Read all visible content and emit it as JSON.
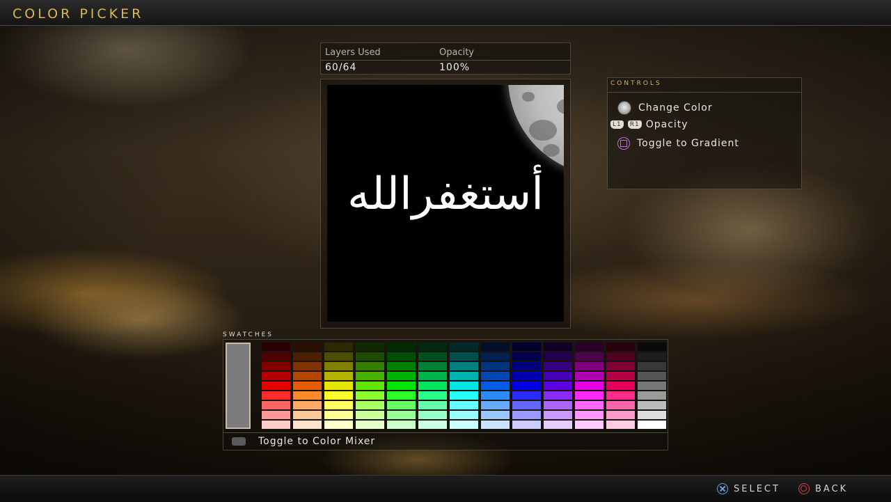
{
  "header": {
    "title": "COLOR PICKER"
  },
  "info": {
    "layers_label": "Layers Used",
    "layers_value": "60/64",
    "opacity_label": "Opacity",
    "opacity_value": "100%"
  },
  "canvas": {
    "calligraphy_text": "أستغفرالله"
  },
  "controls": {
    "title": "CONTROLS",
    "items": [
      {
        "icon": "right-stick-icon",
        "label": "Change Color"
      },
      {
        "icon": "l1-r1-icon",
        "label": "Opacity",
        "icon_text_l": "L1",
        "icon_text_r": "R1"
      },
      {
        "icon": "square-button-icon",
        "label": "Toggle to Gradient"
      }
    ]
  },
  "swatches": {
    "title": "SWATCHES",
    "selected_color": "#7c7c7c",
    "toggle_label": "Toggle to Color Mixer",
    "rows": [
      [
        "#2a0000",
        "#2a1000",
        "#2a2a00",
        "#102a00",
        "#002a00",
        "#002a10",
        "#002a2a",
        "#00102a",
        "#00002a",
        "#10002a",
        "#2a002a",
        "#2a0010",
        "#0a0a0a"
      ],
      [
        "#4d0000",
        "#4d2000",
        "#4d4d00",
        "#1e4d00",
        "#004d00",
        "#004d20",
        "#004d4d",
        "#00204d",
        "#00004d",
        "#20004d",
        "#4d004d",
        "#4d0020",
        "#1c1c1c"
      ],
      [
        "#800000",
        "#803300",
        "#808000",
        "#338000",
        "#008000",
        "#008033",
        "#008080",
        "#003380",
        "#000080",
        "#330080",
        "#800080",
        "#800033",
        "#383838"
      ],
      [
        "#b30000",
        "#b34700",
        "#b3b300",
        "#47b300",
        "#00b300",
        "#00b347",
        "#00b3b3",
        "#0047b3",
        "#0000b3",
        "#4700b3",
        "#b300b3",
        "#b30047",
        "#555555"
      ],
      [
        "#e60000",
        "#e65c00",
        "#e6e600",
        "#5ce600",
        "#00e600",
        "#00e65c",
        "#00e6e6",
        "#005ce6",
        "#0000e6",
        "#5c00e6",
        "#e600e6",
        "#e6005c",
        "#777777"
      ],
      [
        "#ff2a2a",
        "#ff8a2a",
        "#ffff2a",
        "#8aff2a",
        "#2aff2a",
        "#2aff8a",
        "#2affff",
        "#2a8aff",
        "#2a2aff",
        "#8a2aff",
        "#ff2aff",
        "#ff2a8a",
        "#999999"
      ],
      [
        "#ff6666",
        "#ffaa66",
        "#ffff66",
        "#aaff66",
        "#66ff66",
        "#66ffaa",
        "#66ffff",
        "#66aaff",
        "#6666ff",
        "#aa66ff",
        "#ff66ff",
        "#ff66aa",
        "#bbbbbb"
      ],
      [
        "#ff9999",
        "#ffc899",
        "#ffff99",
        "#c8ff99",
        "#99ff99",
        "#99ffc8",
        "#99ffff",
        "#99c8ff",
        "#9999ff",
        "#c899ff",
        "#ff99ff",
        "#ff99c8",
        "#dddddd"
      ],
      [
        "#ffcccc",
        "#ffe4cc",
        "#ffffcc",
        "#e4ffcc",
        "#ccffcc",
        "#ccffe4",
        "#ccffff",
        "#cce4ff",
        "#ccccff",
        "#e4ccff",
        "#ffccff",
        "#ffcce4",
        "#ffffff"
      ]
    ]
  },
  "footer": {
    "select_label": "SELECT",
    "back_label": "BACK"
  }
}
